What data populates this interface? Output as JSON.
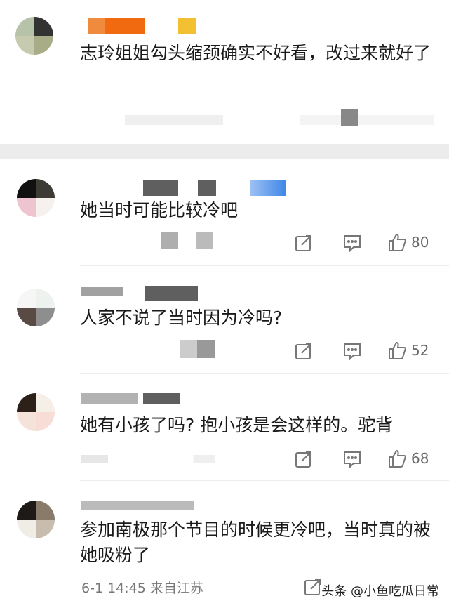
{
  "comments": [
    {
      "text": "志玲姐姐勾头缩颈确实不好看，改过来就好了",
      "meta": "",
      "likes": ""
    },
    {
      "text": "她当时可能比较冷吧",
      "meta": "",
      "likes": "80"
    },
    {
      "text": "人家不说了当时因为冷吗?",
      "meta": "",
      "likes": "52"
    },
    {
      "text": "她有小孩了吗? 抱小孩是会这样的。驼背",
      "meta": "",
      "likes": "68"
    },
    {
      "text": "参加南极那个节目的时候更冷吧，当时真的被她吸粉了",
      "meta": "6-1 14:45 来自江苏",
      "likes": ""
    }
  ],
  "watermark": "头条 @小鱼吃瓜日常",
  "colors": {
    "icon": "#777777",
    "text": "#1a1a1a",
    "meta": "#888888",
    "divider": "#ececec"
  },
  "icons": [
    "share-icon",
    "comment-icon",
    "like-icon"
  ]
}
